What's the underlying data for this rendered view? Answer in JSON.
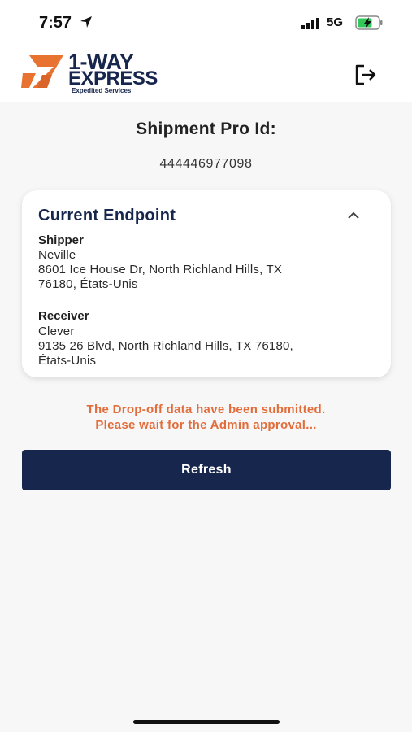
{
  "status_bar": {
    "time": "7:57",
    "network": "5G",
    "icons": [
      "location-arrow-icon",
      "signal-bars-icon",
      "battery-charging-icon"
    ]
  },
  "header": {
    "logo_line1": "1-WAY",
    "logo_line2": "EXPRESS",
    "logo_sub": "Expedited Services",
    "logout_icon": "logout-icon"
  },
  "shipment": {
    "title": "Shipment Pro Id:",
    "value": "444446977098"
  },
  "endpoint": {
    "title": "Current Endpoint",
    "shipper_label": "Shipper",
    "shipper_name": "Neville",
    "shipper_address_line1": "8601 Ice House Dr, North Richland Hills, TX",
    "shipper_address_line2": "76180, États-Unis",
    "receiver_label": "Receiver",
    "receiver_name": "Clever",
    "receiver_address_line1": "9135 26 Blvd, North Richland Hills, TX 76180,",
    "receiver_address_line2": "États-Unis"
  },
  "notice": {
    "line1": "The Drop-off data have been submitted.",
    "line2": "Please wait for the Admin approval..."
  },
  "actions": {
    "refresh_label": "Refresh"
  },
  "colors": {
    "brand_navy": "#17264d",
    "brand_orange": "#e8722f",
    "notice_orange": "#e26d3b"
  }
}
